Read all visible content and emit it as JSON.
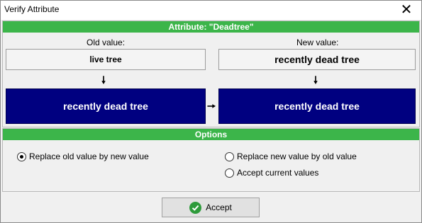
{
  "window": {
    "title": "Verify Attribute",
    "close_glyph": "✕"
  },
  "attribute": {
    "header": "Attribute: \"Deadtree\"",
    "old_label": "Old value:",
    "new_label": "New value:",
    "old_value": "live tree",
    "new_value": "recently dead tree",
    "result_left": "recently dead tree",
    "result_right": "recently dead tree",
    "result_color": "#000080",
    "header_color": "#3cb54a"
  },
  "options": {
    "header": "Options",
    "replace_old": "Replace old value by new value",
    "replace_new": "Replace new value by old value",
    "accept_current": "Accept current values",
    "selected": "replace_old"
  },
  "accept_button": {
    "label": "Accept",
    "icon": "checkmark-icon"
  }
}
